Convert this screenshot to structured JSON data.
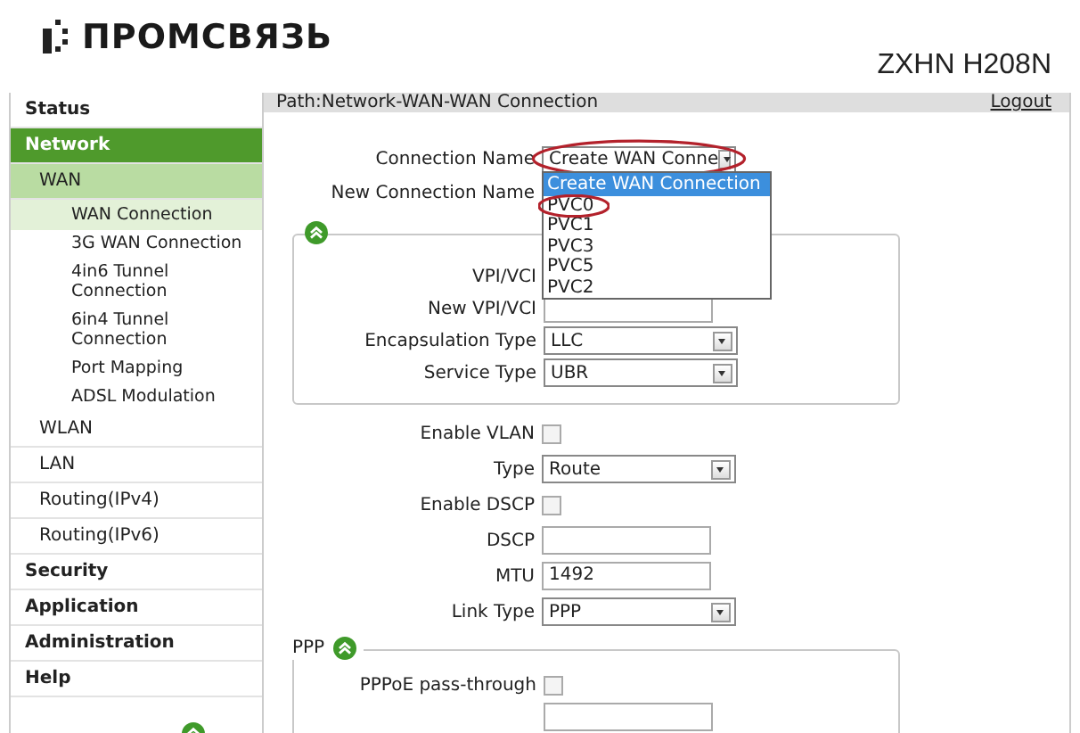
{
  "header": {
    "logo": "ПРОМСВЯЗЬ",
    "model": "ZXHN H208N"
  },
  "sidebar": {
    "items": [
      {
        "label": "Status",
        "selected": false
      },
      {
        "label": "Network",
        "selected": true,
        "children": [
          {
            "label": "WAN",
            "selected": true,
            "children": [
              {
                "label": "WAN Connection",
                "selected": true
              },
              {
                "label": "3G WAN Connection",
                "selected": false
              },
              {
                "label": "4in6 Tunnel Connection",
                "selected": false
              },
              {
                "label": "6in4 Tunnel Connection",
                "selected": false
              },
              {
                "label": "Port Mapping",
                "selected": false
              },
              {
                "label": "ADSL Modulation",
                "selected": false
              }
            ]
          },
          {
            "label": "WLAN",
            "selected": false
          },
          {
            "label": "LAN",
            "selected": false
          },
          {
            "label": "Routing(IPv4)",
            "selected": false
          },
          {
            "label": "Routing(IPv6)",
            "selected": false
          }
        ]
      },
      {
        "label": "Security",
        "selected": false
      },
      {
        "label": "Application",
        "selected": false
      },
      {
        "label": "Administration",
        "selected": false
      },
      {
        "label": "Help",
        "selected": false
      }
    ]
  },
  "path": "Path:Network-WAN-WAN Connection",
  "logout": "Logout",
  "connection_name": {
    "label": "Connection Name",
    "value": "Create WAN Conne",
    "circled": true,
    "options": [
      {
        "label": "Create WAN Connection",
        "selected": true,
        "circled": false
      },
      {
        "label": "PVC0",
        "selected": false,
        "circled": true
      },
      {
        "label": "PVC1",
        "selected": false,
        "circled": false
      },
      {
        "label": "PVC3",
        "selected": false,
        "circled": false
      },
      {
        "label": "PVC5",
        "selected": false,
        "circled": false
      },
      {
        "label": "PVC2",
        "selected": false,
        "circled": false
      }
    ]
  },
  "new_connection_name": {
    "label": "New Connection Name"
  },
  "atm_section": {
    "fields": [
      {
        "kind": "hidden",
        "label": "VPI/VCI"
      },
      {
        "kind": "text",
        "label": "New VPI/VCI"
      },
      {
        "kind": "select",
        "label": "Encapsulation Type",
        "value": "LLC"
      },
      {
        "kind": "select",
        "label": "Service Type",
        "value": "UBR"
      }
    ]
  },
  "fields": [
    {
      "kind": "checkbox",
      "label": "Enable VLAN",
      "checked": false
    },
    {
      "kind": "select",
      "label": "Type",
      "value": "Route"
    },
    {
      "kind": "checkbox",
      "label": "Enable DSCP",
      "checked": false
    },
    {
      "kind": "text",
      "label": "DSCP"
    },
    {
      "kind": "text",
      "label": "MTU",
      "value": "1492"
    },
    {
      "kind": "select",
      "label": "Link Type",
      "value": "PPP"
    }
  ],
  "ppp_section": {
    "legend": "PPP",
    "fields": [
      {
        "kind": "checkbox",
        "label": "PPPoE pass-through",
        "checked": false
      },
      {
        "kind": "text"
      }
    ]
  }
}
